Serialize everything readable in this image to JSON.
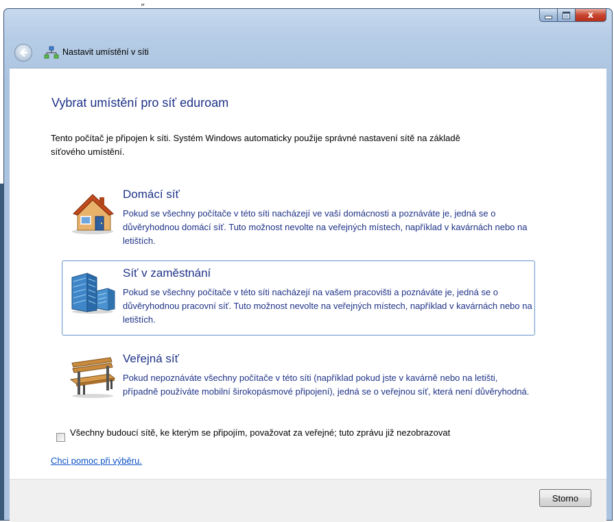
{
  "backdrop": {
    "stray_text": "„"
  },
  "window": {
    "title": "Nastavit umístění v síti",
    "caption": {
      "close_glyph": "x"
    }
  },
  "main": {
    "heading": "Vybrat umístění pro síť eduroam",
    "intro": "Tento počítač je připojen k síti. Systém Windows automaticky použije správné nastavení sítě na základě síťového umístění.",
    "options": [
      {
        "title": "Domácí síť",
        "description": "Pokud se všechny počítače v této síti nacházejí ve vaší domácnosti a poznáváte je, jedná se o důvěryhodnou domácí síť. Tuto možnost nevolte na veřejných místech, například v kavárnách nebo na letištích.",
        "icon": "house-icon"
      },
      {
        "title": "Síť v zaměstnání",
        "description": "Pokud se všechny počítače v této síti nacházejí na vašem pracovišti a poznáváte je, jedná se o důvěryhodnou pracovní síť. Tuto možnost nevolte na veřejných místech, například v kavárnách nebo na letištích.",
        "icon": "office-building-icon",
        "focused": true
      },
      {
        "title": "Veřejná síť",
        "description": "Pokud nepoznáváte všechny počítače v této síti (například pokud jste v kavárně nebo na letišti, případně používáte mobilní širokopásmové připojení), jedná se o veřejnou síť, která není důvěryhodná.",
        "icon": "park-bench-icon"
      }
    ],
    "checkbox": {
      "label": "Všechny budoucí sítě, ke kterým se připojím, považovat za veřejné; tuto zprávu již nezobrazovat",
      "checked": false
    },
    "help_link": "Chci pomoc při výběru."
  },
  "footer": {
    "cancel_label": "Storno"
  },
  "colors": {
    "heading": "#1e3287",
    "link": "#0b51c5",
    "close_button": "#c8452f",
    "focus_border": "#7da2ce"
  }
}
